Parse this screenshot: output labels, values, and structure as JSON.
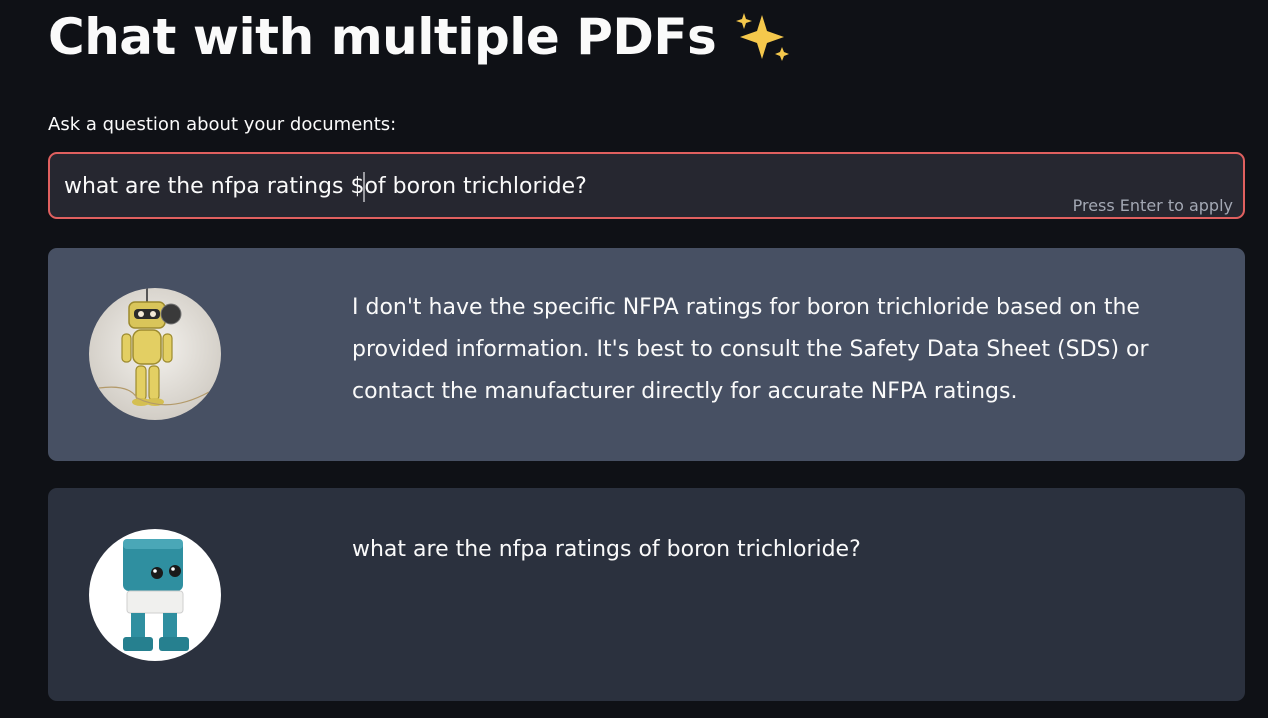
{
  "header": {
    "title": "Chat with multiple PDFs",
    "title_icon": "sparkles-icon"
  },
  "question": {
    "label": "Ask a question about your documents:",
    "value_before_caret": "what are the nfpa ratings $",
    "value_after_caret": "of boron trichloride?",
    "hint": "Press Enter to apply",
    "border_color": "#e0605f"
  },
  "messages": [
    {
      "role": "bot",
      "avatar": "robot-avatar-icon",
      "text": "I don't have the specific NFPA ratings for boron trichloride based on the provided information. It's best to consult the Safety Data Sheet (SDS) or contact the manufacturer directly for accurate NFPA ratings.",
      "background": "#475063"
    },
    {
      "role": "user",
      "avatar": "user-robot-avatar-icon",
      "text": "what are the nfpa ratings of boron trichloride?",
      "background": "#2b313e"
    }
  ],
  "colors": {
    "page_background": "#0f1116",
    "input_background": "#262730"
  }
}
